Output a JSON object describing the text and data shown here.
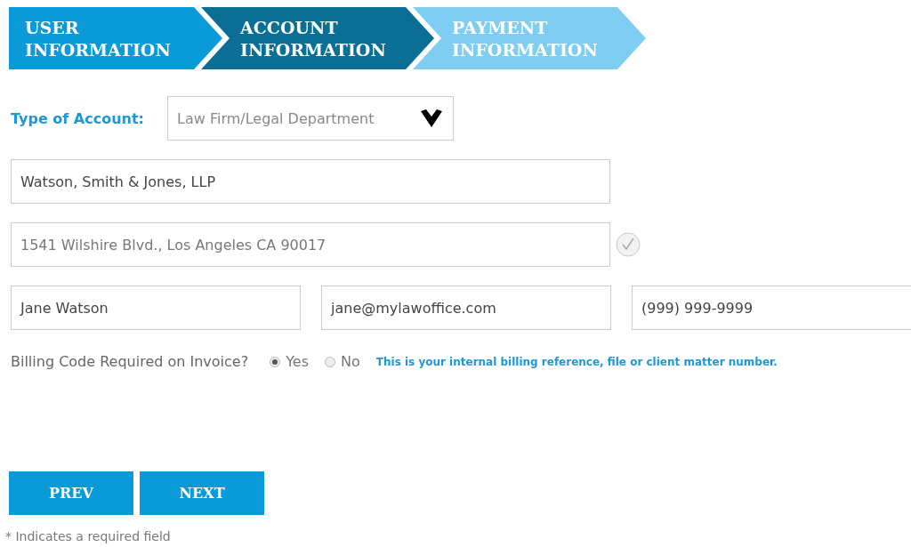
{
  "steps": [
    {
      "label": "USER INFORMATION",
      "kind": "done"
    },
    {
      "label": "ACCOUNT INFORMATION",
      "kind": "current"
    },
    {
      "label": "PAYMENT INFORMATION",
      "kind": "upcoming"
    }
  ],
  "account_type": {
    "label": "Type of Account:",
    "value": "Law Firm/Legal Department"
  },
  "company": {
    "value": "Watson, Smith & Jones, LLP"
  },
  "address": {
    "value": "1541 Wilshire Blvd., Los Angeles CA 90017",
    "verified": true
  },
  "contact": [
    {
      "value": "Jane Watson"
    },
    {
      "value": "jane@mylawoffice.com"
    },
    {
      "value": "(999) 999-9999"
    }
  ],
  "billing_code": {
    "question": "Billing Code Required on Invoice?",
    "options": [
      {
        "label": "Yes",
        "selected": true
      },
      {
        "label": "No",
        "selected": false
      }
    ],
    "hint": "This is your internal billing reference, file or client matter number."
  },
  "buttons": [
    "PREV",
    "NEXT"
  ],
  "footnote": "* Indicates a required field"
}
